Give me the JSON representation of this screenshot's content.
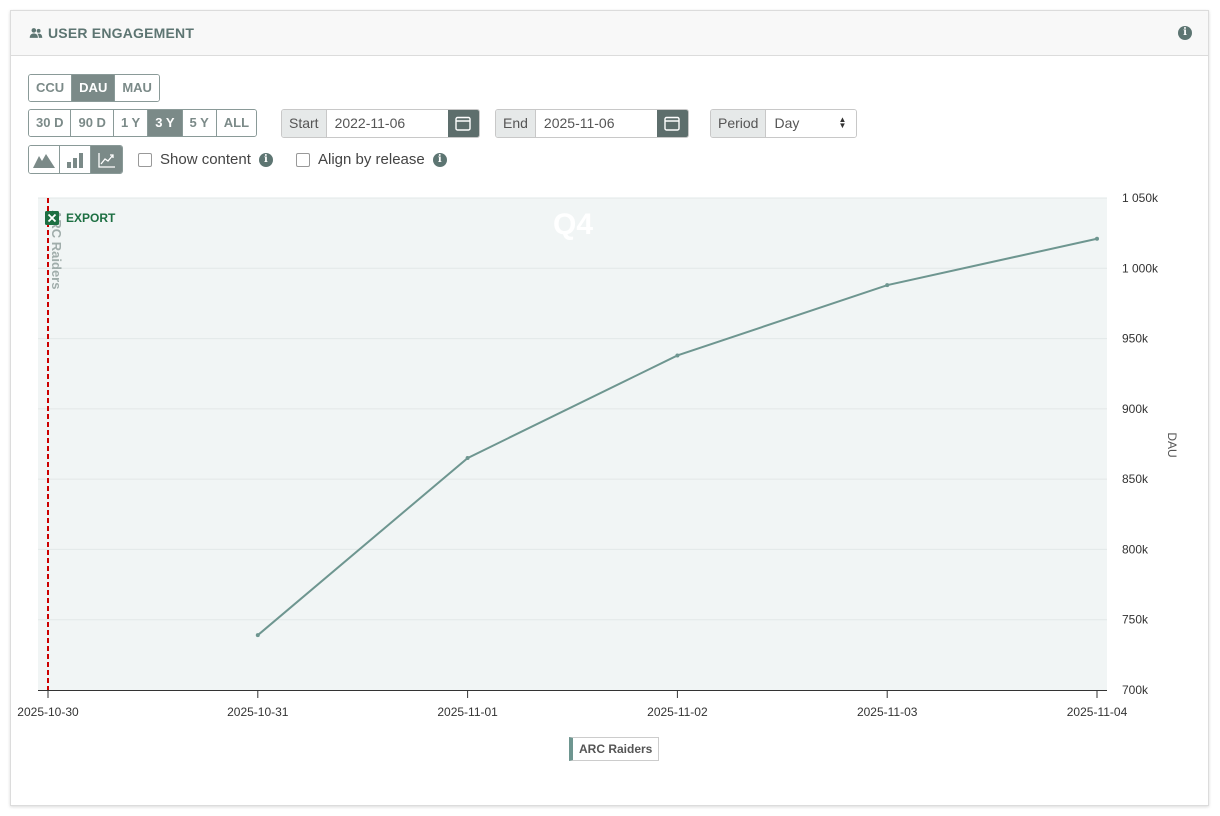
{
  "header": {
    "title": "USER ENGAGEMENT",
    "icon": "users-icon",
    "info_icon": "info-icon"
  },
  "metric_tabs": [
    {
      "label": "CCU",
      "active": false
    },
    {
      "label": "DAU",
      "active": true
    },
    {
      "label": "MAU",
      "active": false
    }
  ],
  "range_tabs": [
    {
      "label": "30 D",
      "active": false
    },
    {
      "label": "90 D",
      "active": false
    },
    {
      "label": "1 Y",
      "active": false
    },
    {
      "label": "3 Y",
      "active": true
    },
    {
      "label": "5 Y",
      "active": false
    },
    {
      "label": "ALL",
      "active": false
    }
  ],
  "start": {
    "label": "Start",
    "value": "2022-11-06"
  },
  "end": {
    "label": "End",
    "value": "2025-11-06"
  },
  "period": {
    "label": "Period",
    "value": "Day"
  },
  "chart_types": [
    "mountain-chart-icon",
    "bar-chart-icon",
    "line-chart-icon"
  ],
  "options": {
    "show_content": "Show content",
    "align_by_release": "Align by release"
  },
  "export_label": "EXPORT",
  "colors": {
    "accent": "#5d7572",
    "series": "#6e9690",
    "release_marker": "#cc0000",
    "plot_bg": "#f1f5f5"
  },
  "chart_data": {
    "type": "line",
    "x": [
      "2025-10-30",
      "2025-10-31",
      "2025-11-01",
      "2025-11-02",
      "2025-11-03",
      "2025-11-04"
    ],
    "series": [
      {
        "name": "ARC Raiders",
        "values": [
          null,
          739000,
          865000,
          938000,
          988000,
          1021000
        ]
      }
    ],
    "ylabel": "DAU",
    "ylim": [
      700000,
      1050000
    ],
    "yticks": [
      "700k",
      "750k",
      "800k",
      "850k",
      "900k",
      "950k",
      "1 000k",
      "1 050k"
    ],
    "y_axis_side": "right",
    "annotations": [
      {
        "type": "release-line",
        "x": "2025-10-30",
        "label": "ARC Raiders"
      },
      {
        "type": "period-band",
        "label": "Q4"
      }
    ],
    "grid": true,
    "legend": "bottom-center"
  }
}
